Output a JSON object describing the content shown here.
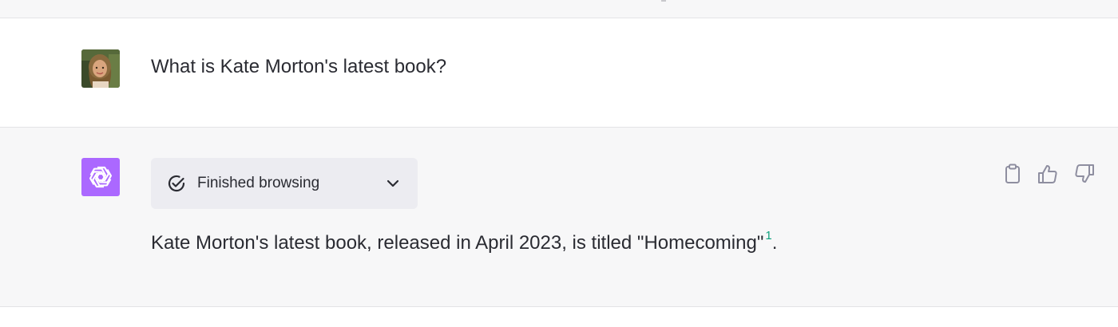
{
  "conversation": {
    "user_message": {
      "text": "What is Kate Morton's latest book?",
      "avatar_icon": "user-photo-avatar"
    },
    "assistant_message": {
      "avatar_icon": "openai-logo-icon",
      "browsing_status": {
        "label": "Finished browsing",
        "status_icon": "check-circle-icon",
        "toggle_icon": "chevron-down-icon"
      },
      "answer": {
        "text": "Kate Morton's latest book, released in April 2023, is titled \"Homecoming\"",
        "citation": "1",
        "trailing": "."
      },
      "actions": [
        {
          "name": "copy",
          "icon": "clipboard-icon"
        },
        {
          "name": "thumbs-up",
          "icon": "thumbs-up-icon"
        },
        {
          "name": "thumbs-down",
          "icon": "thumbs-down-icon"
        }
      ]
    }
  },
  "colors": {
    "assistant_bg": "#f7f7f8",
    "logo_bg": "#ab68ff",
    "citation": "#10a37f",
    "pill_bg": "#ececf1",
    "icon_gray": "#8e8ea0"
  }
}
